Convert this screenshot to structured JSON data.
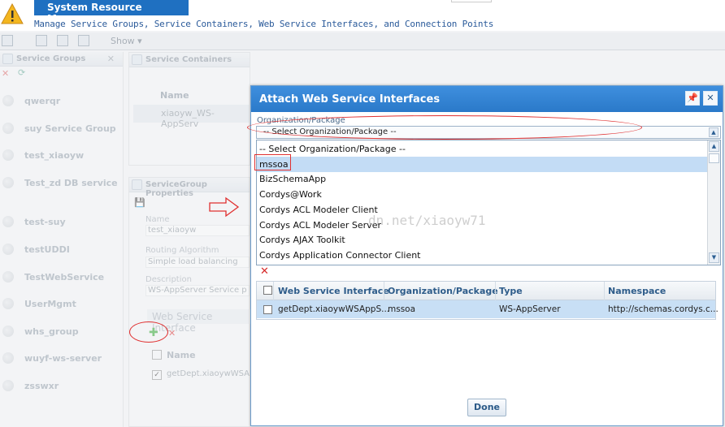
{
  "app": {
    "title": "System Resource Manager",
    "subtitle": "Manage Service Groups, Service Containers, Web Service Interfaces, and Connection Points"
  },
  "toolbar": {
    "show_label": "Show ▾"
  },
  "left_panel": {
    "title": "Service Groups",
    "items": [
      "qwerqr",
      "suy Service Group",
      "test_xiaoyw",
      "Test_zd DB service",
      "test-suy",
      "testUDDI",
      "TestWebService",
      "UserMgmt",
      "whs_group",
      "wuyf-ws-server",
      "zsswxr"
    ]
  },
  "containers_panel": {
    "title": "Service Containers",
    "col_name": "Name",
    "row": "xiaoyw_WS-AppServ"
  },
  "props_panel": {
    "title": "ServiceGroup Properties",
    "name_label": "Name",
    "name_value": "test_xiaoyw",
    "routing_label": "Routing Algorithm",
    "routing_value": "Simple load balancing",
    "desc_label": "Description",
    "desc_value": "WS-AppServer Service p",
    "wsi_header": "Web Service Interface",
    "col_name": "Name",
    "row": "getDept.xiaoywWSA"
  },
  "modal": {
    "title": "Attach Web Service Interfaces",
    "org_label": "Organization/Package",
    "select_value": "-- Select Organization/Package --",
    "options": [
      "-- Select Organization/Package --",
      "mssoa",
      "BizSchemaApp",
      "Cordys@Work",
      "Cordys ACL Modeler Client",
      "Cordys ACL Modeler Server",
      "Cordys AJAX Toolkit",
      "Cordys Application Connector Client"
    ],
    "selected_option": "mssoa",
    "grid": {
      "columns": [
        "Web Service Interface",
        "Organization/Package",
        "Type",
        "Namespace"
      ],
      "rows": [
        {
          "interface": "getDept.xiaoywWSAppS...",
          "package": "mssoa",
          "type": "WS-AppServer",
          "namespace": "http://schemas.cordys.c..."
        }
      ]
    },
    "done_label": "Done"
  },
  "watermark": "dn.net/xiaoyw71",
  "colors": {
    "accent": "#1f70c1",
    "modal_header": "#2a79c9",
    "selection": "#c3dcf5",
    "annotation": "#e03030"
  }
}
